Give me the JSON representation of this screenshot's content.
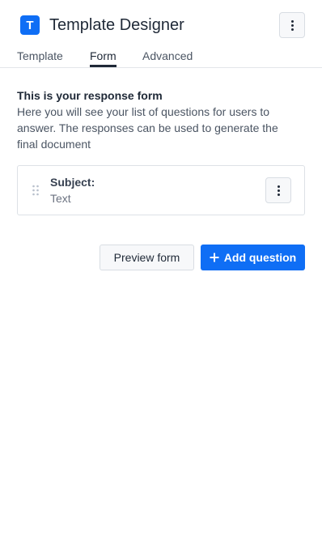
{
  "header": {
    "logo_letter": "T",
    "title": "Template Designer",
    "menu_icon": "more-vertical-icon"
  },
  "tabs": [
    {
      "label": "Template",
      "active": false
    },
    {
      "label": "Form",
      "active": true
    },
    {
      "label": "Advanced",
      "active": false
    }
  ],
  "intro": {
    "title": "This is your response form",
    "description": "Here you will see your list of questions for users to answer. The responses can be used to generate the final document"
  },
  "questions": [
    {
      "label": "Subject:",
      "type": "Text"
    }
  ],
  "actions": {
    "preview_label": "Preview form",
    "add_label": "Add question"
  },
  "colors": {
    "accent": "#0f6ef5",
    "text": "#1f2937",
    "muted": "#6b7280"
  }
}
